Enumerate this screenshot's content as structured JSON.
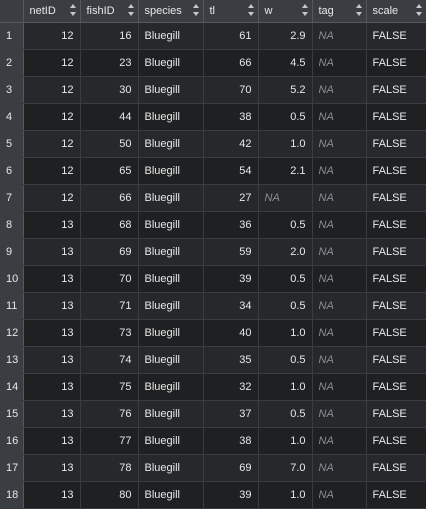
{
  "columns": [
    {
      "key": "row",
      "label": ""
    },
    {
      "key": "netID",
      "label": "netID"
    },
    {
      "key": "fishID",
      "label": "fishID"
    },
    {
      "key": "species",
      "label": "species"
    },
    {
      "key": "tl",
      "label": "tl"
    },
    {
      "key": "w",
      "label": "w"
    },
    {
      "key": "tag",
      "label": "tag"
    },
    {
      "key": "scale",
      "label": "scale"
    }
  ],
  "sort_icon": "sort-up-down-icon",
  "rows": [
    {
      "row": "1",
      "netID": "12",
      "fishID": "16",
      "species": "Bluegill",
      "tl": "61",
      "w": "2.9",
      "tag": "NA",
      "scale": "FALSE"
    },
    {
      "row": "2",
      "netID": "12",
      "fishID": "23",
      "species": "Bluegill",
      "tl": "66",
      "w": "4.5",
      "tag": "NA",
      "scale": "FALSE"
    },
    {
      "row": "3",
      "netID": "12",
      "fishID": "30",
      "species": "Bluegill",
      "tl": "70",
      "w": "5.2",
      "tag": "NA",
      "scale": "FALSE"
    },
    {
      "row": "4",
      "netID": "12",
      "fishID": "44",
      "species": "Bluegill",
      "tl": "38",
      "w": "0.5",
      "tag": "NA",
      "scale": "FALSE"
    },
    {
      "row": "5",
      "netID": "12",
      "fishID": "50",
      "species": "Bluegill",
      "tl": "42",
      "w": "1.0",
      "tag": "NA",
      "scale": "FALSE"
    },
    {
      "row": "6",
      "netID": "12",
      "fishID": "65",
      "species": "Bluegill",
      "tl": "54",
      "w": "2.1",
      "tag": "NA",
      "scale": "FALSE"
    },
    {
      "row": "7",
      "netID": "12",
      "fishID": "66",
      "species": "Bluegill",
      "tl": "27",
      "w": "NA",
      "tag": "NA",
      "scale": "FALSE"
    },
    {
      "row": "8",
      "netID": "13",
      "fishID": "68",
      "species": "Bluegill",
      "tl": "36",
      "w": "0.5",
      "tag": "NA",
      "scale": "FALSE"
    },
    {
      "row": "9",
      "netID": "13",
      "fishID": "69",
      "species": "Bluegill",
      "tl": "59",
      "w": "2.0",
      "tag": "NA",
      "scale": "FALSE"
    },
    {
      "row": "10",
      "netID": "13",
      "fishID": "70",
      "species": "Bluegill",
      "tl": "39",
      "w": "0.5",
      "tag": "NA",
      "scale": "FALSE"
    },
    {
      "row": "11",
      "netID": "13",
      "fishID": "71",
      "species": "Bluegill",
      "tl": "34",
      "w": "0.5",
      "tag": "NA",
      "scale": "FALSE"
    },
    {
      "row": "12",
      "netID": "13",
      "fishID": "73",
      "species": "Bluegill",
      "tl": "40",
      "w": "1.0",
      "tag": "NA",
      "scale": "FALSE"
    },
    {
      "row": "13",
      "netID": "13",
      "fishID": "74",
      "species": "Bluegill",
      "tl": "35",
      "w": "0.5",
      "tag": "NA",
      "scale": "FALSE"
    },
    {
      "row": "14",
      "netID": "13",
      "fishID": "75",
      "species": "Bluegill",
      "tl": "32",
      "w": "1.0",
      "tag": "NA",
      "scale": "FALSE"
    },
    {
      "row": "15",
      "netID": "13",
      "fishID": "76",
      "species": "Bluegill",
      "tl": "37",
      "w": "0.5",
      "tag": "NA",
      "scale": "FALSE"
    },
    {
      "row": "16",
      "netID": "13",
      "fishID": "77",
      "species": "Bluegill",
      "tl": "38",
      "w": "1.0",
      "tag": "NA",
      "scale": "FALSE"
    },
    {
      "row": "17",
      "netID": "13",
      "fishID": "78",
      "species": "Bluegill",
      "tl": "69",
      "w": "7.0",
      "tag": "NA",
      "scale": "FALSE"
    },
    {
      "row": "18",
      "netID": "13",
      "fishID": "80",
      "species": "Bluegill",
      "tl": "39",
      "w": "1.0",
      "tag": "NA",
      "scale": "FALSE"
    }
  ]
}
